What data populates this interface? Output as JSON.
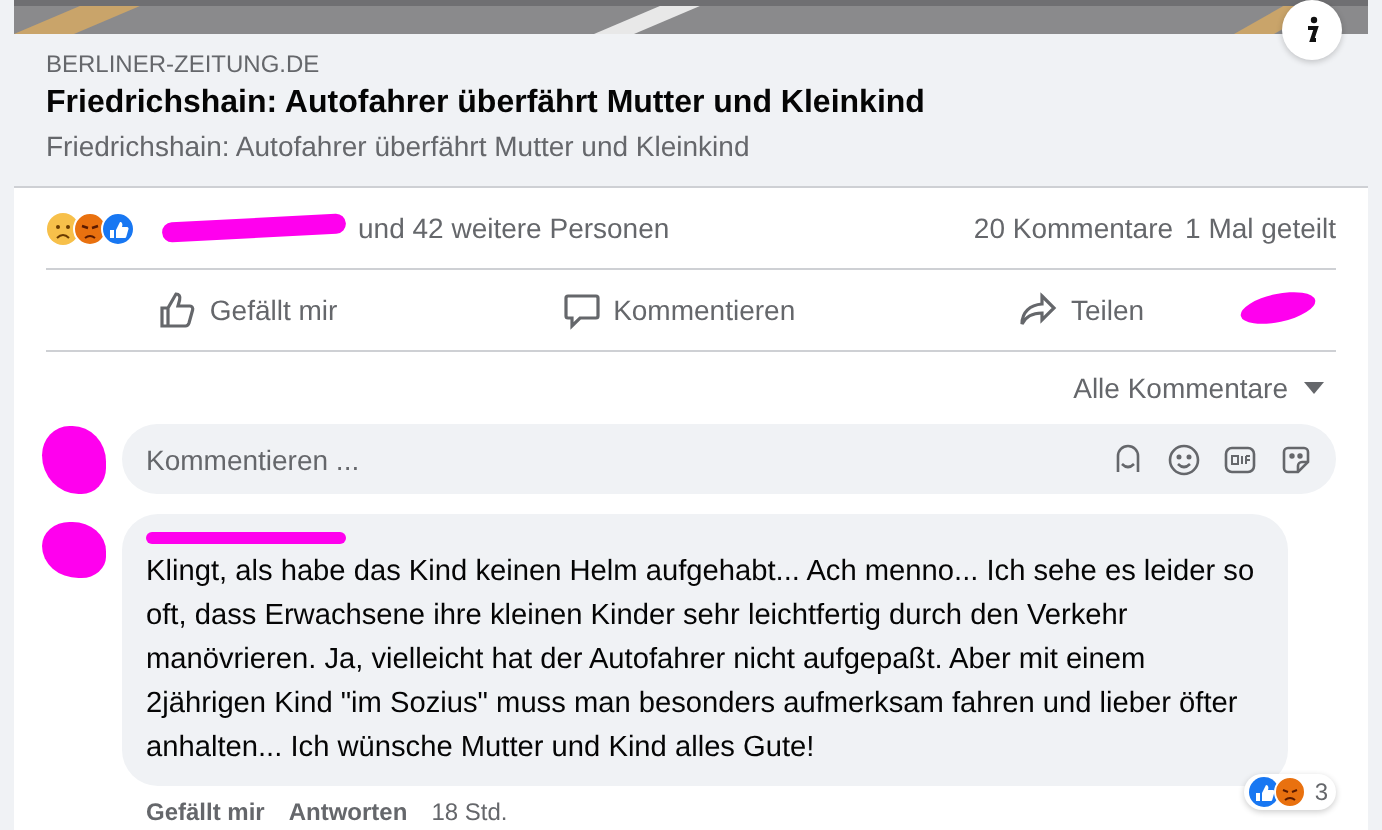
{
  "link_preview": {
    "domain": "BERLINER-ZEITUNG.DE",
    "title": "Friedrichshain: Autofahrer überfährt Mutter und Kleinkind",
    "description": "Friedrichshain: Autofahrer überfährt Mutter und Kleinkind"
  },
  "reactions": {
    "summary": "und 42 weitere Personen",
    "comments": "20 Kommentare",
    "shares": "1 Mal geteilt"
  },
  "actions": [
    {
      "label": "Gefällt mir",
      "kind": "like"
    },
    {
      "label": "Kommentieren",
      "kind": "comment"
    },
    {
      "label": "Teilen",
      "kind": "share"
    }
  ],
  "comment_filter": "Alle Kommentare",
  "composer": {
    "placeholder": "Kommentieren ..."
  },
  "comments": [
    {
      "text": "Klingt, als habe das Kind keinen Helm aufgehabt... Ach menno... Ich sehe es leider so oft, dass Erwachsene ihre kleinen Kinder sehr leichtfertig durch den Verkehr manövrieren. Ja, vielleicht hat der Autofahrer nicht aufgepaßt. Aber mit einem 2jährigen Kind \"im Sozius\" muss man besonders aufmerksam fahren und lieber öfter anhalten... Ich wünsche Mutter und Kind alles Gute!",
      "reaction_count": "3",
      "actions": [
        "Gefällt mir",
        "Antworten"
      ],
      "time": "18 Std."
    }
  ]
}
